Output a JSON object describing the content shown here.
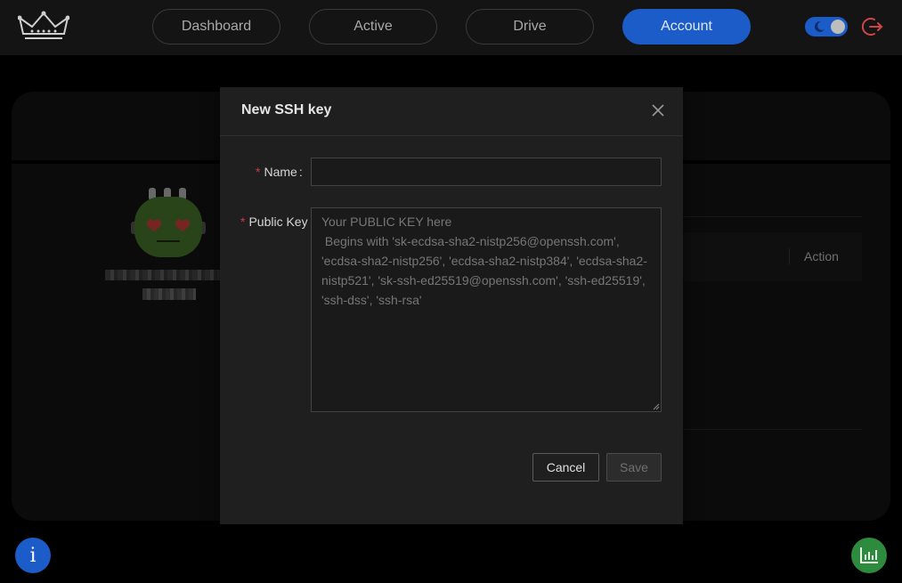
{
  "nav": {
    "logo_icon": "crown-icon",
    "tabs": [
      {
        "label": "Dashboard",
        "active": false
      },
      {
        "label": "Active",
        "active": false
      },
      {
        "label": "Drive",
        "active": false
      },
      {
        "label": "Account",
        "active": true
      }
    ],
    "theme_toggle_icon": "moon-icon",
    "logout_icon": "logout-icon"
  },
  "background": {
    "table_action_header": "Action"
  },
  "modal": {
    "title": "New SSH key",
    "name_label": "Name",
    "name_colon": ":",
    "name_value": "",
    "public_key_label": "Public Key",
    "public_key_placeholder": "Your PUBLIC KEY here\n Begins with 'sk-ecdsa-sha2-nistp256@openssh.com', 'ecdsa-sha2-nistp256', 'ecdsa-sha2-nistp384', 'ecdsa-sha2-nistp521', 'sk-ssh-ed25519@openssh.com', 'ssh-ed25519', 'ssh-dss', 'ssh-rsa'",
    "cancel_label": "Cancel",
    "save_label": "Save"
  },
  "fab": {
    "info_label": "i"
  },
  "colors": {
    "accent": "#1c5cc9",
    "required": "#d03b3b",
    "chart_fab": "#2e8b3e",
    "logout": "#d04545"
  }
}
